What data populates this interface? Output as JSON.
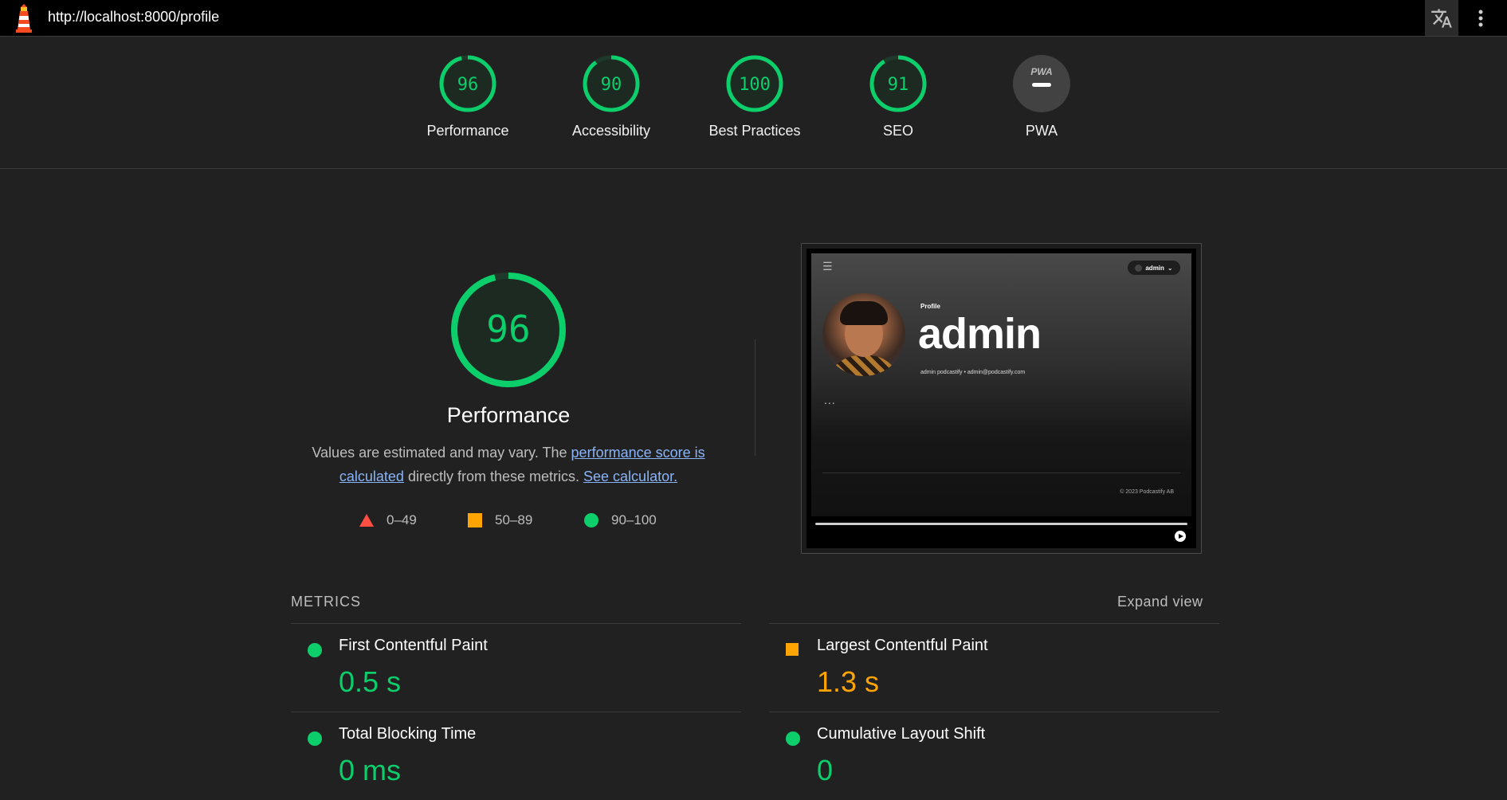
{
  "topbar": {
    "url": "http://localhost:8000/profile",
    "logo_icon": "lighthouse-icon",
    "translate_icon": "translate-icon",
    "menu_icon": "more-vert-icon"
  },
  "gauges": [
    {
      "score": "96",
      "value": 96,
      "label": "Performance"
    },
    {
      "score": "90",
      "value": 90,
      "label": "Accessibility"
    },
    {
      "score": "100",
      "value": 100,
      "label": "Best Practices"
    },
    {
      "score": "91",
      "value": 91,
      "label": "SEO"
    },
    {
      "score": "",
      "value": null,
      "label": "PWA",
      "badge_text": "PWA"
    }
  ],
  "performance": {
    "score": "96",
    "value": 96,
    "title": "Performance",
    "desc_prefix": "Values are estimated and may vary. The ",
    "desc_link": "performance score is calculated",
    "desc_middle": " directly from these metrics. ",
    "desc_link2": "See calculator.",
    "legend": [
      {
        "range": "0–49",
        "shape": "triangle",
        "color": "#ff4e42"
      },
      {
        "range": "50–89",
        "shape": "square",
        "color": "#ffa400"
      },
      {
        "range": "90–100",
        "shape": "circle",
        "color": "#0cce6b"
      }
    ]
  },
  "screenshot": {
    "user_chip": "admin",
    "profile_label": "Profile",
    "name": "admin",
    "meta": "admin podcastify  •  admin@podcastify.com",
    "dots": "...",
    "copyright": "© 2023 Podcastify AB"
  },
  "metrics": {
    "title": "METRICS",
    "expand": "Expand view",
    "items": [
      {
        "name": "First Contentful Paint",
        "value": "0.5 s",
        "status": "pass"
      },
      {
        "name": "Largest Contentful Paint",
        "value": "1.3 s",
        "status": "average"
      },
      {
        "name": "Total Blocking Time",
        "value": "0 ms",
        "status": "pass"
      },
      {
        "name": "Cumulative Layout Shift",
        "value": "0",
        "status": "pass"
      }
    ]
  },
  "colors": {
    "pass": "#0cce6b",
    "average": "#ffa400",
    "fail": "#ff4e42",
    "background": "#212121"
  }
}
